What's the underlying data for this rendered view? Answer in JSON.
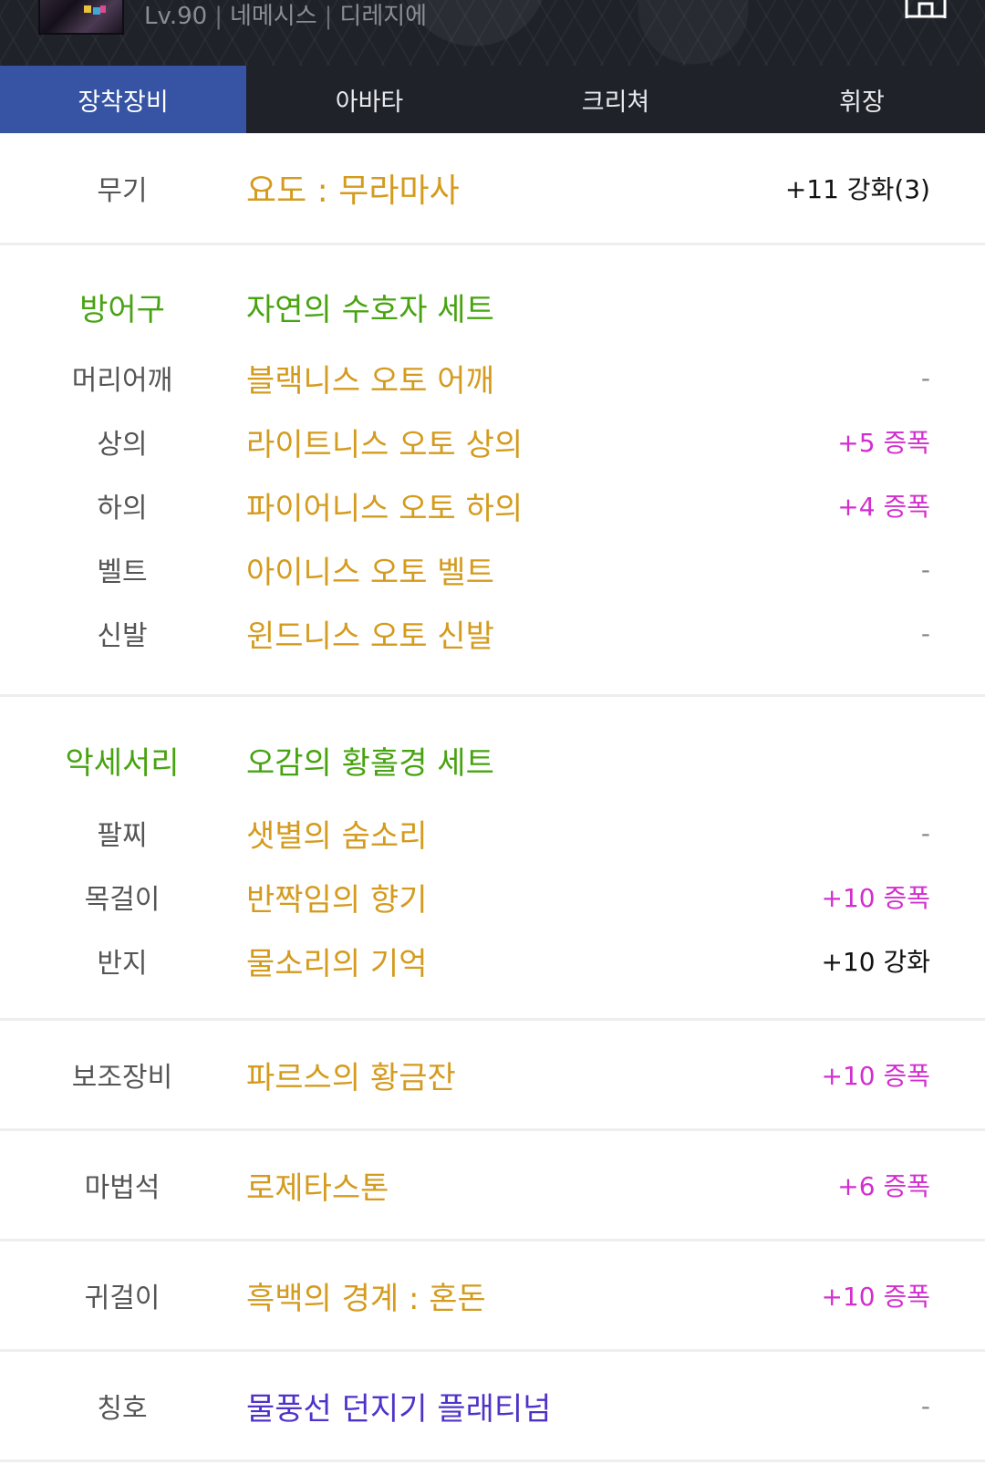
{
  "header": {
    "level": "Lv.90",
    "server": "네메시스",
    "job": "디레지에",
    "separator": "|"
  },
  "tabs": [
    {
      "label": "장착장비",
      "active": true
    },
    {
      "label": "아바타",
      "active": false
    },
    {
      "label": "크리쳐",
      "active": false
    },
    {
      "label": "휘장",
      "active": false
    }
  ],
  "weapon": {
    "category": "무기",
    "name": "요도 : 무라마사",
    "stat": "+11 강화(3)"
  },
  "armor": {
    "category": "방어구",
    "set_name": "자연의 수호자 세트",
    "items": [
      {
        "slot": "머리어깨",
        "name": "블랙니스 오토 어깨",
        "stat": "-"
      },
      {
        "slot": "상의",
        "name": "라이트니스 오토 상의",
        "stat": "+5 증폭"
      },
      {
        "slot": "하의",
        "name": "파이어니스 오토 하의",
        "stat": "+4 증폭"
      },
      {
        "slot": "벨트",
        "name": "아이니스 오토 벨트",
        "stat": "-"
      },
      {
        "slot": "신발",
        "name": "윈드니스 오토 신발",
        "stat": "-"
      }
    ]
  },
  "accessory": {
    "category": "악세서리",
    "set_name": "오감의 황홀경 세트",
    "items": [
      {
        "slot": "팔찌",
        "name": "샛별의 숨소리",
        "stat": "-"
      },
      {
        "slot": "목걸이",
        "name": "반짝임의 향기",
        "stat": "+10 증폭"
      },
      {
        "slot": "반지",
        "name": "물소리의 기억",
        "stat": "+10 강화"
      }
    ]
  },
  "sub_weapon": {
    "category": "보조장비",
    "name": "파르스의 황금잔",
    "stat": "+10 증폭"
  },
  "magic_stone": {
    "category": "마법석",
    "name": "로제타스톤",
    "stat": "+6 증폭"
  },
  "earring": {
    "category": "귀걸이",
    "name": "흑백의 경계 : 혼돈",
    "stat": "+10 증폭"
  },
  "title_item": {
    "category": "칭호",
    "name": "물풍선 던지기 플래티넘",
    "stat": "-"
  },
  "colors": {
    "tab_active": "#3654a3",
    "header_bg": "#1f2229",
    "item_name": "#d49b1e",
    "set_green": "#48a311",
    "amp_magenta": "#d22fcf",
    "title_purple": "#4f33c9"
  },
  "icons": {
    "home": "home-icon",
    "avatar": "character-avatar"
  }
}
